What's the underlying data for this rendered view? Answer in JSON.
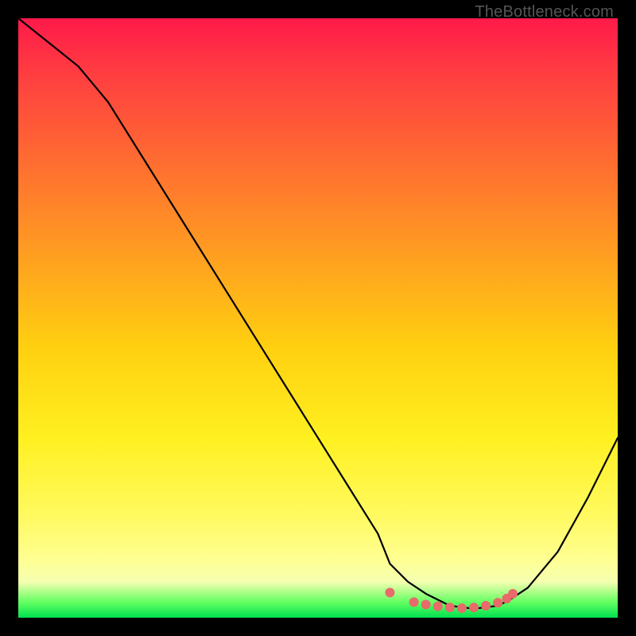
{
  "watermark": "TheBottleneck.com",
  "chart_data": {
    "type": "line",
    "title": "",
    "xlabel": "",
    "ylabel": "",
    "xlim": [
      0,
      100
    ],
    "ylim": [
      0,
      100
    ],
    "series": [
      {
        "name": "bottleneck-curve",
        "x": [
          0,
          5,
          10,
          15,
          20,
          25,
          30,
          35,
          40,
          45,
          50,
          55,
          60,
          62,
          65,
          68,
          72,
          76,
          80,
          82,
          85,
          90,
          95,
          100
        ],
        "y": [
          100,
          96,
          92,
          86,
          78,
          70,
          62,
          54,
          46,
          38,
          30,
          22,
          14,
          9,
          6,
          4,
          2,
          1.5,
          2,
          3,
          5,
          11,
          20,
          30
        ]
      }
    ],
    "markers": {
      "name": "highlight-dots",
      "color": "#e86a6a",
      "points": [
        {
          "x": 62,
          "y": 4.2
        },
        {
          "x": 66,
          "y": 2.6
        },
        {
          "x": 68,
          "y": 2.2
        },
        {
          "x": 70,
          "y": 1.9
        },
        {
          "x": 72,
          "y": 1.7
        },
        {
          "x": 74,
          "y": 1.6
        },
        {
          "x": 76,
          "y": 1.7
        },
        {
          "x": 78,
          "y": 2.0
        },
        {
          "x": 80,
          "y": 2.5
        },
        {
          "x": 81.5,
          "y": 3.2
        },
        {
          "x": 82.5,
          "y": 4.0
        }
      ]
    },
    "gradient_stops": [
      {
        "pos": 0,
        "color": "#ff1a4a"
      },
      {
        "pos": 0.1,
        "color": "#ff4040"
      },
      {
        "pos": 0.25,
        "color": "#ff7030"
      },
      {
        "pos": 0.4,
        "color": "#ffa020"
      },
      {
        "pos": 0.55,
        "color": "#ffd010"
      },
      {
        "pos": 0.7,
        "color": "#fff020"
      },
      {
        "pos": 0.83,
        "color": "#fffa60"
      },
      {
        "pos": 0.9,
        "color": "#ffff90"
      },
      {
        "pos": 0.94,
        "color": "#f5ffb0"
      },
      {
        "pos": 0.975,
        "color": "#60ff60"
      },
      {
        "pos": 1.0,
        "color": "#00e050"
      }
    ]
  }
}
